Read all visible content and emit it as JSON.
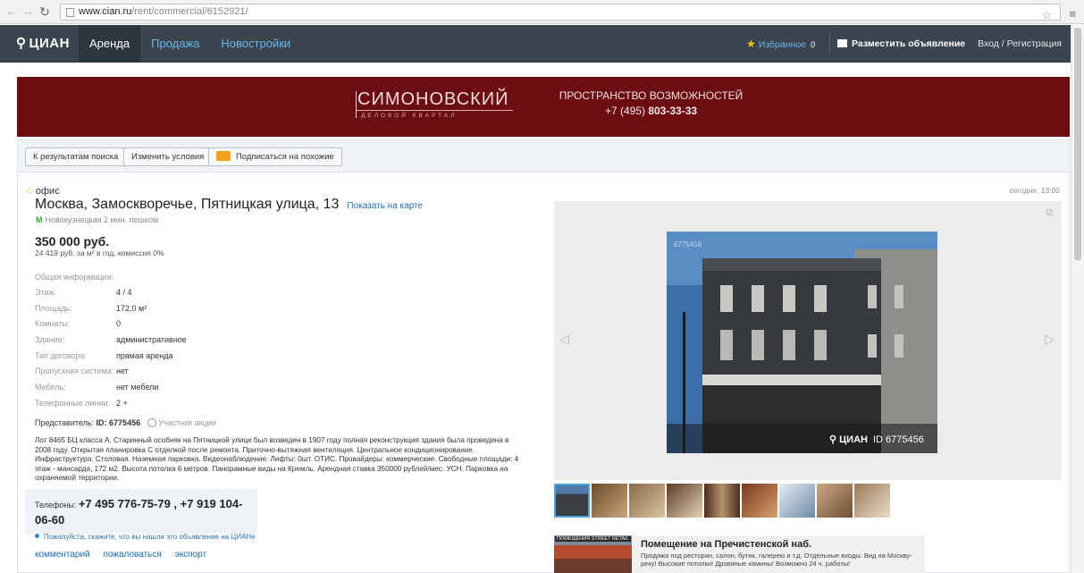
{
  "browser": {
    "url_host": "www.cian.ru",
    "url_path": "/rent/commercial/6152921/"
  },
  "site": {
    "logo": "ЦИАН",
    "tabs": [
      {
        "label": "Аренда"
      },
      {
        "label": "Продажа"
      },
      {
        "label": "Новостройки"
      }
    ],
    "favorites_label": "Избранное",
    "favorites_count": "0",
    "post_ad_label": "Разместить объявление",
    "login_label": "Вход / Регистрация"
  },
  "banner": {
    "brand_name": "СИМОНОВСКИЙ",
    "brand_sub": "ДЕЛОВОЙ КВАРТАЛ",
    "slogan": "ПРОСТРАНСТВО ВОЗМОЖНОСТЕЙ",
    "phone_prefix": "+7 (495) ",
    "phone_main": "803-33-33",
    "bg_color": "#6c0d12"
  },
  "toolbar": {
    "back_label": "К результатам поиска",
    "change_label": "Изменить условия",
    "subscribe_label": "Подписаться на похожие"
  },
  "listing": {
    "kind": "офис",
    "date": "сегодня, 13:00",
    "address": "Москва, Замоскворечье, Пятницкая улица, 13",
    "map_link": "Показать на карте",
    "metro": "Новокузнецкая 2 мин. пешком",
    "price": "350 000 руб.",
    "price_sub": "24 419 руб. за м² в год, комиссия 0%",
    "info_header": "Общая информация:",
    "rows": [
      {
        "k": "Этаж:",
        "v": "4 / 4"
      },
      {
        "k": "Площадь:",
        "v": "172,0 м²"
      },
      {
        "k": "Комнаты:",
        "v": "0"
      },
      {
        "k": "Здание:",
        "v": "административное"
      },
      {
        "k": "Тип договора:",
        "v": "прямая аренда"
      },
      {
        "k": "Пропускная система:",
        "v": "нет"
      },
      {
        "k": "Мебель:",
        "v": "нет мебели"
      },
      {
        "k": "Телефонные линии:",
        "v": "2 +"
      }
    ],
    "agent_label": "Представитель: ",
    "agent_id": "ID: 6775456",
    "agent_badge": "Участник акции",
    "description": "Лот 8465 БЦ класса А. Старинный особняк на Пятницкой улице был возведен в 1907 году полная реконструкция здания была проведена в 2008 году. Открытая планировка С отделкой после ремонта. Приточно-вытяжная вентиляция. Центральное кондиционирование. Инфраструктура: Столовая. Наземная парковка. Видеонаблюдение. Лифты: 0шт. ОТИС. Провайдеры: коммерческие. Свободные площади: 4 этаж - мансарда, 172 м2. Высота потолка 6 метров. Панорамные виды на Кремль. Арендная ставка 350000 рублей/мес. УСН. Парковка на охраняемой территории.",
    "phones_label": "Телефоны: ",
    "phones": "+7 495 776-75-79 , +7 919 104-06-60",
    "phones_hint": "Пожалуйста, скажите, что вы нашли это объявление на ЦИАНе",
    "links": [
      "комментарий",
      "пожаловаться",
      "экспорт"
    ]
  },
  "gallery": {
    "photo_watermark_id": "6775456",
    "watermark_logo": "ЦИАН",
    "watermark_id": "ID 6775456",
    "thumb_count": 9,
    "selected_index": 0
  },
  "ad": {
    "image_tag": "ПОМЕЩЕНИЯ STREET RETAIL",
    "title": "Помещение на Пречистенской наб.",
    "text": "Продажа под ресторан, салон, бутик, галерею и т.д. Отдельные входы. Вид на Москву-реку! Высокие потолки! Дровяные камины! Возможно 24 ч. работы!"
  },
  "colors": {
    "topbar": "#3a4550",
    "link": "#1a6bb8",
    "accent": "#6ab4e8"
  },
  "icons": [
    "back-arrow-icon",
    "forward-arrow-icon",
    "reload-icon",
    "page-icon",
    "bookmark-star-icon",
    "browser-menu-icon",
    "favorites-star-icon",
    "post-ad-icon",
    "envelope-icon",
    "metro-icon",
    "verified-check-icon",
    "gallery-prev-icon",
    "gallery-next-icon",
    "expand-icon"
  ]
}
